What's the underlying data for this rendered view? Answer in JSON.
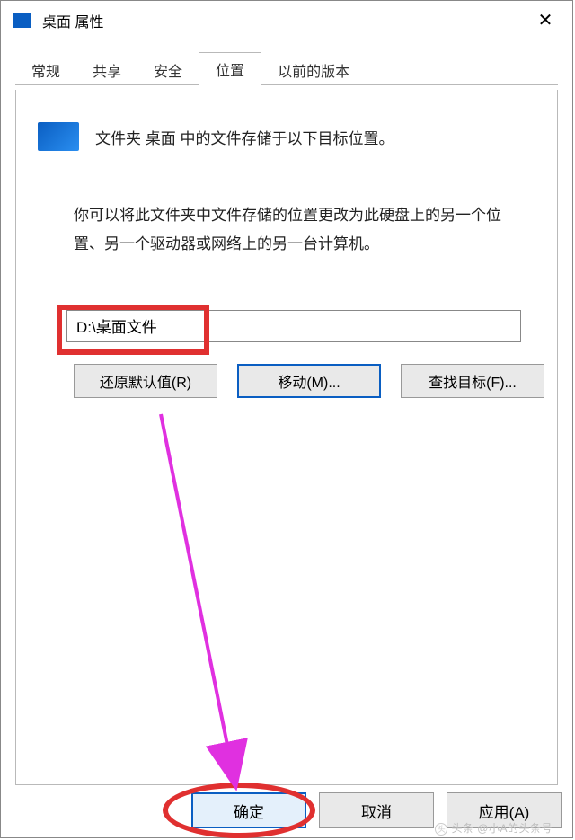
{
  "window": {
    "title": "桌面 属性",
    "close_glyph": "✕"
  },
  "tabs": {
    "general": "常规",
    "sharing": "共享",
    "security": "安全",
    "location": "位置",
    "previous": "以前的版本",
    "active": "location"
  },
  "location": {
    "intro": "文件夹 桌面 中的文件存储于以下目标位置。",
    "description": "你可以将此文件夹中文件存储的位置更改为此硬盘上的另一个位置、另一个驱动器或网络上的另一台计算机。",
    "path_value": "D:\\桌面文件",
    "buttons": {
      "restore": "还原默认值(R)",
      "move": "移动(M)...",
      "find": "查找目标(F)..."
    }
  },
  "dialog_buttons": {
    "ok": "确定",
    "cancel": "取消",
    "apply": "应用(A)"
  },
  "watermark": "头条 @小A的头条号"
}
